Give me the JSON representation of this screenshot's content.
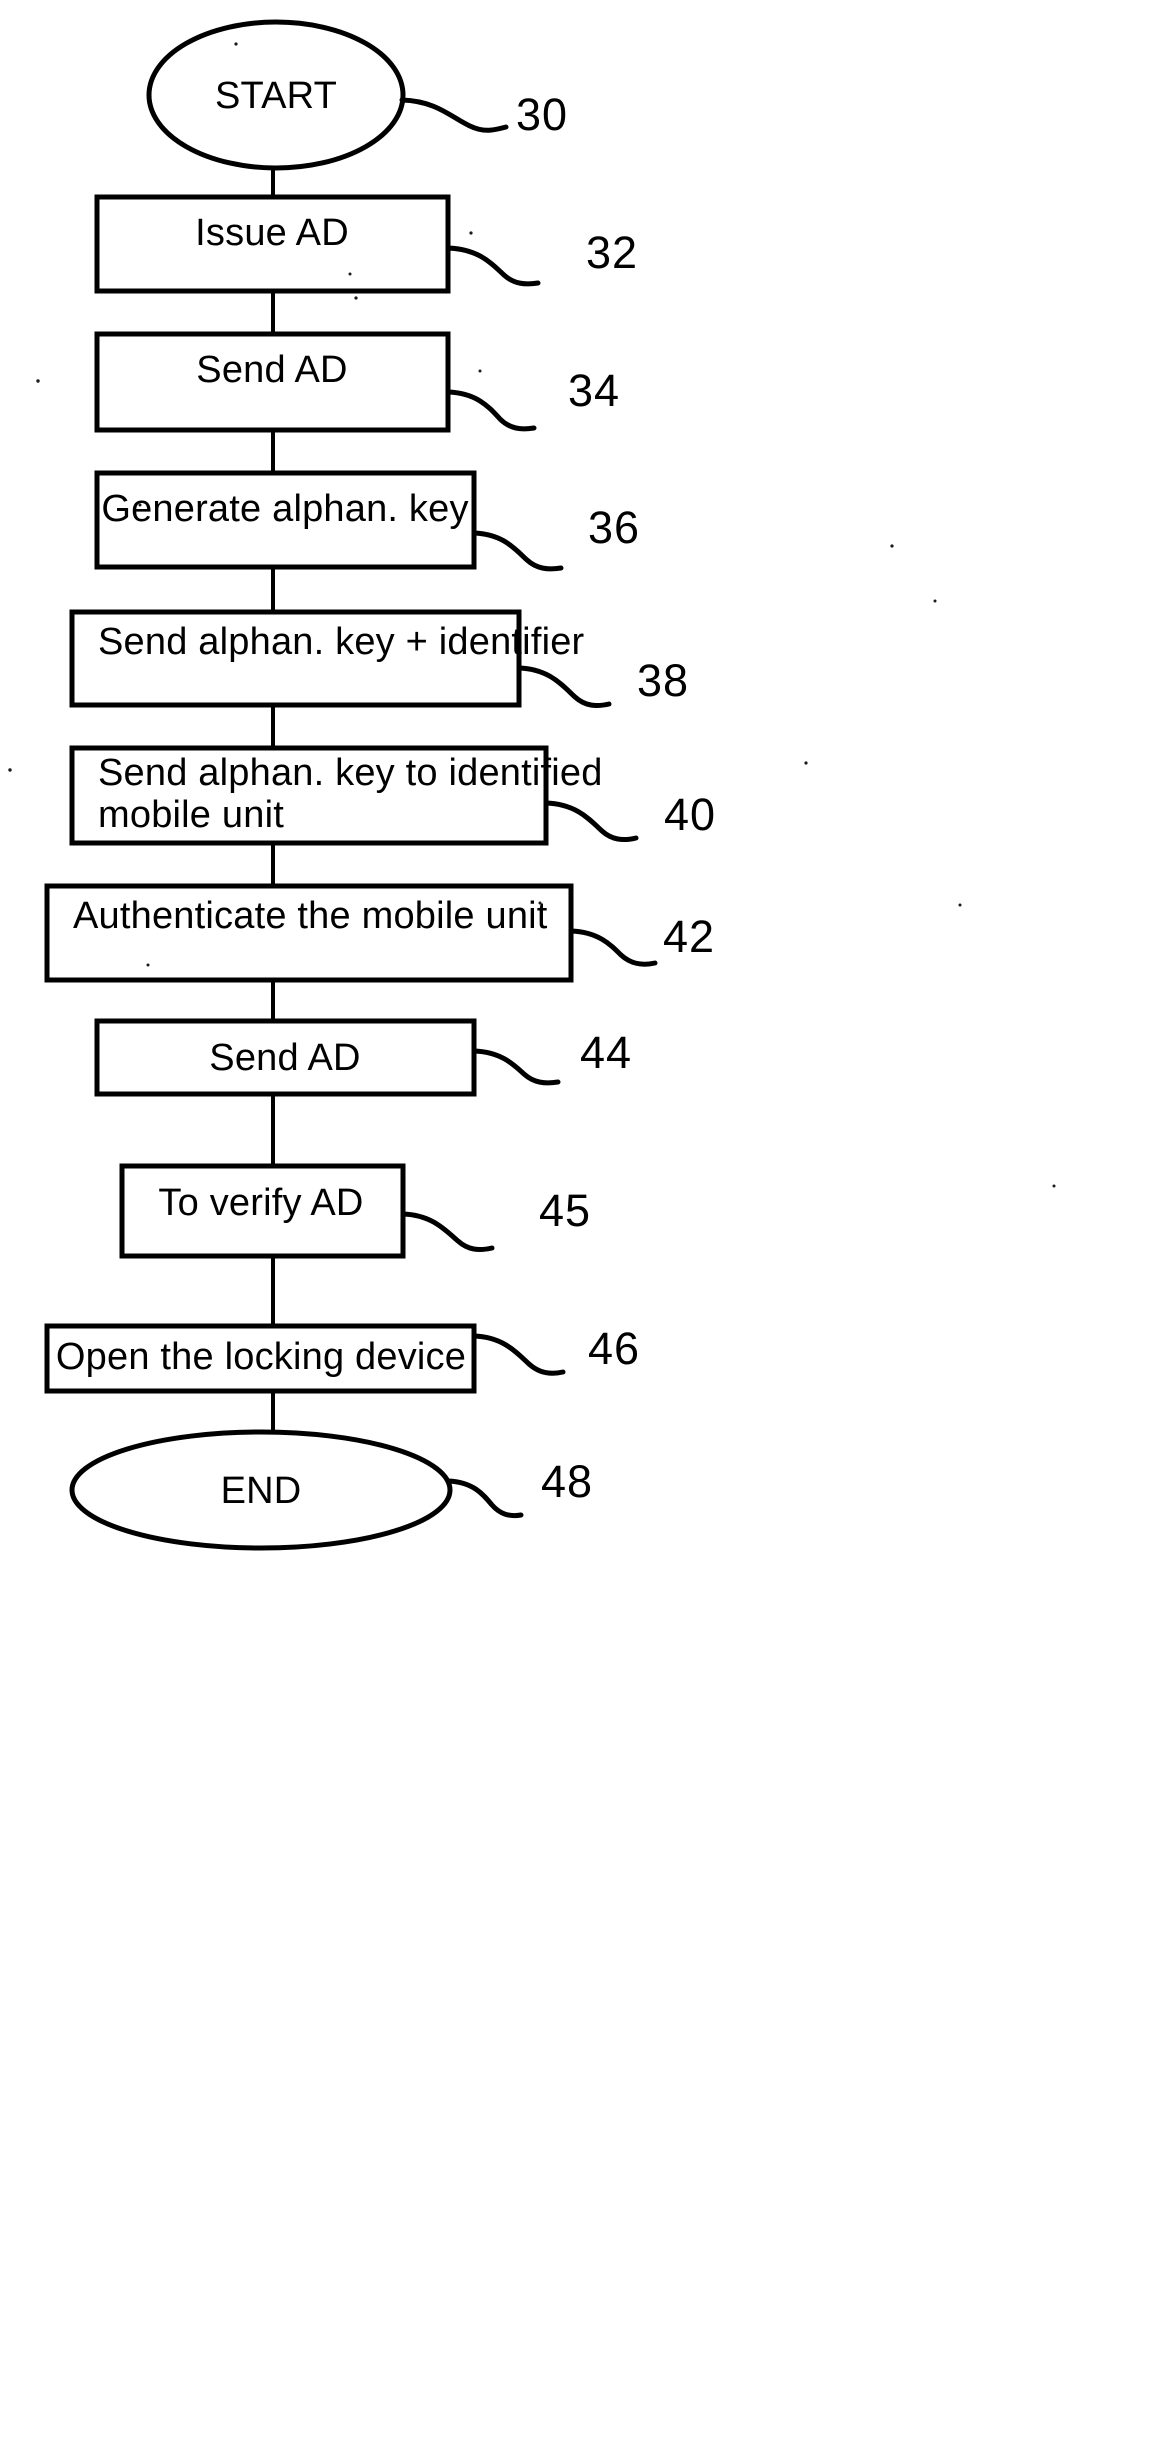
{
  "figure": {
    "kind": "patent-flowchart",
    "orientation": "vertical",
    "ink_color": "#000000",
    "paper_color": "#ffffff"
  },
  "nodes": [
    {
      "id": "start",
      "shape": "ellipse",
      "label": "START",
      "ref": "30",
      "align": "center",
      "lines": [
        "START"
      ]
    },
    {
      "id": "issue-ad",
      "shape": "rect",
      "label": "Issue AD",
      "ref": "32",
      "align": "center",
      "lines": [
        "Issue AD"
      ]
    },
    {
      "id": "send-ad-1",
      "shape": "rect",
      "label": "Send AD",
      "ref": "34",
      "align": "center",
      "lines": [
        "Send AD"
      ]
    },
    {
      "id": "generate-key",
      "shape": "rect",
      "label": "Generate alphan. key",
      "ref": "36",
      "align": "center",
      "lines": [
        "Generate alphan. key"
      ]
    },
    {
      "id": "send-key-identifier",
      "shape": "rect",
      "label": "Send alphan. key + identifier",
      "ref": "38",
      "align": "left",
      "lines": [
        "Send alphan. key + identifier"
      ]
    },
    {
      "id": "send-key-mobile",
      "shape": "rect",
      "label": "Send alphan. key to identified mobile unit",
      "ref": "40",
      "align": "left",
      "lines": [
        "Send alphan. key to identified",
        "mobile unit"
      ]
    },
    {
      "id": "authenticate",
      "shape": "rect",
      "label": "Authenticate the mobile unit",
      "ref": "42",
      "align": "left",
      "lines": [
        "Authenticate the mobile unit"
      ]
    },
    {
      "id": "send-ad-2",
      "shape": "rect",
      "label": "Send AD",
      "ref": "44",
      "align": "center",
      "lines": [
        "Send AD"
      ]
    },
    {
      "id": "verify-ad",
      "shape": "rect",
      "label": "To verify AD",
      "ref": "45",
      "align": "center",
      "lines": [
        "To verify AD"
      ]
    },
    {
      "id": "open-lock",
      "shape": "rect",
      "label": "Open the locking device",
      "ref": "46",
      "align": "center",
      "lines": [
        "Open the locking device"
      ]
    },
    {
      "id": "end",
      "shape": "ellipse",
      "label": "END",
      "ref": "48",
      "align": "center",
      "lines": [
        "END"
      ]
    }
  ],
  "labels": {
    "start": "START",
    "issue_ad": "Issue AD",
    "send_ad_1": "Send AD",
    "generate_key": "Generate alphan. key",
    "send_key_identifier": "Send alphan. key + identifier",
    "send_key_mobile_l1": "Send alphan. key to identified",
    "send_key_mobile_l2": "mobile unit",
    "authenticate": "Authenticate the mobile unit",
    "send_ad_2": "Send AD",
    "verify_ad": "To verify AD",
    "open_lock": "Open the locking device",
    "end": "END"
  },
  "refs": {
    "start": "30",
    "issue_ad": "32",
    "send_ad_1": "34",
    "generate_key": "36",
    "send_key_identifier": "38",
    "send_key_mobile": "40",
    "authenticate": "42",
    "send_ad_2": "44",
    "verify_ad": "45",
    "open_lock": "46",
    "end": "48"
  }
}
